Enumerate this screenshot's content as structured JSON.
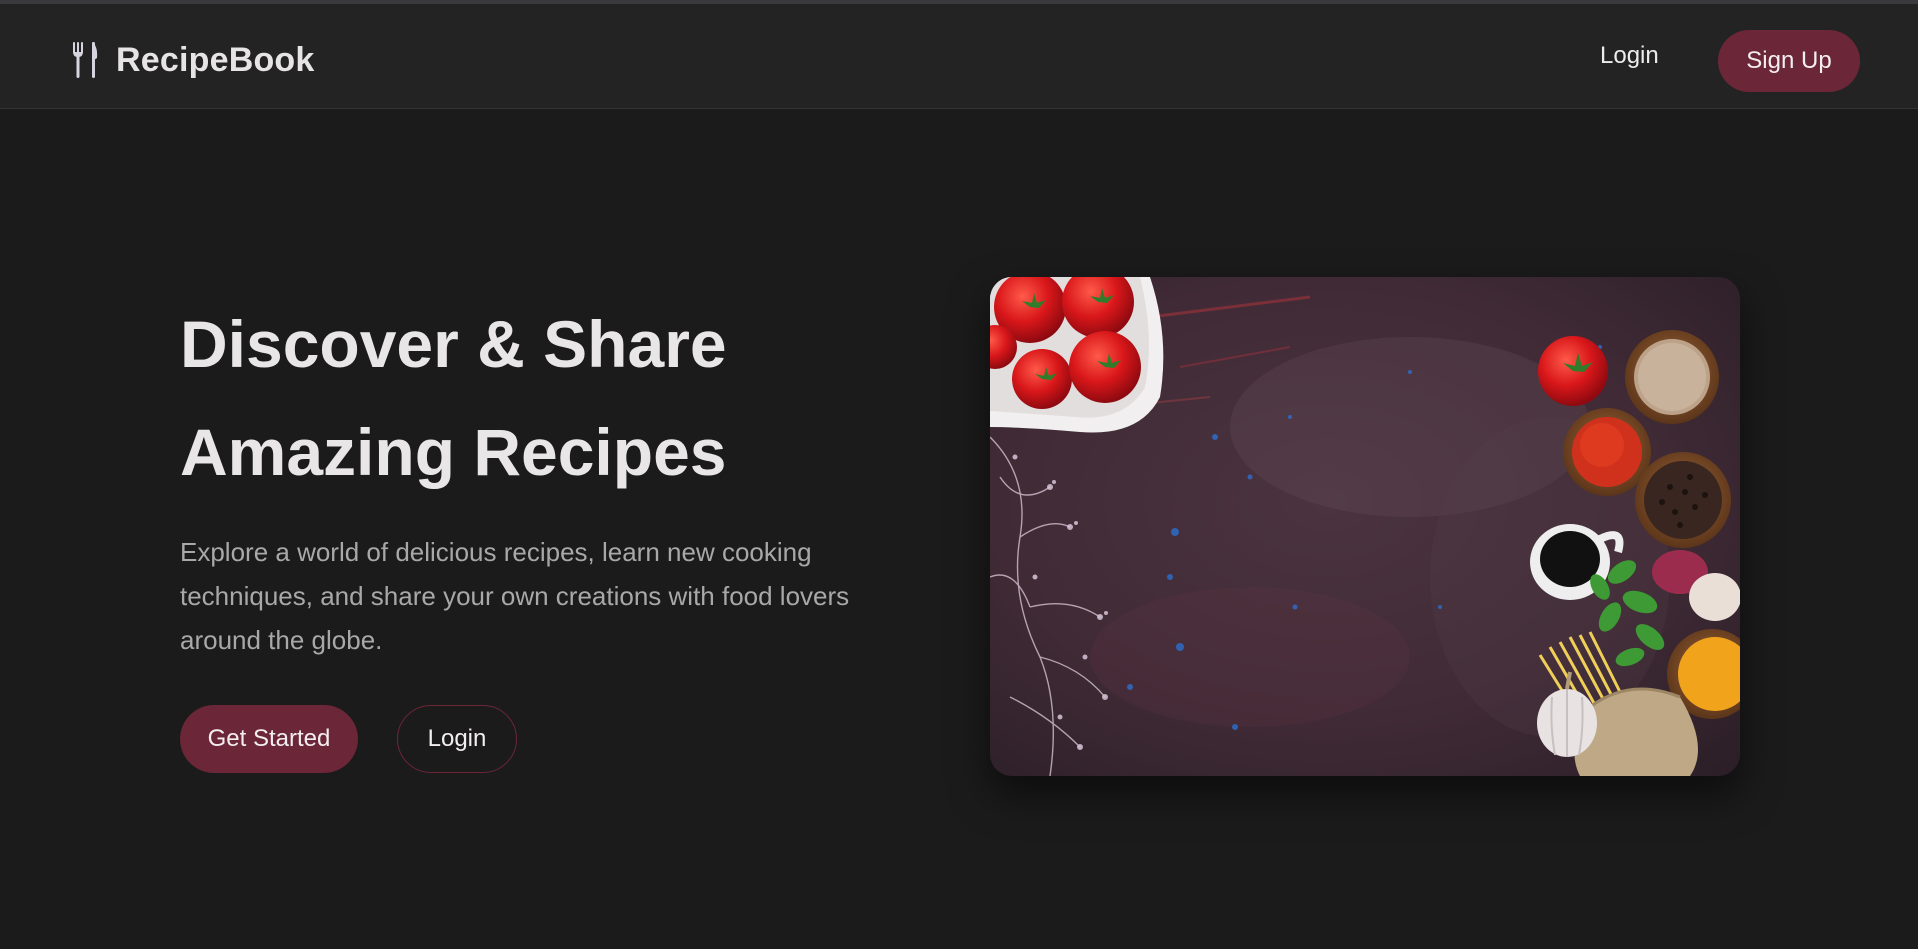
{
  "navbar": {
    "brand_icon": "fork-knife-icon",
    "brand_name": "RecipeBook",
    "login_label": "Login",
    "signup_label": "Sign Up"
  },
  "hero": {
    "title_line1": "Discover & Share",
    "title_line2": "Amazing Recipes",
    "description": "Explore a world of delicious recipes, learn new cooking techniques, and share your own creations with food lovers around the globe.",
    "primary_button": "Get Started",
    "secondary_button": "Login",
    "image_alt": "Overhead view of tomatoes, spices, pasta and herbs on a dark surface"
  },
  "colors": {
    "background": "#1b1b1c",
    "navbar": "#232324",
    "accent": "#6b2637",
    "heading": "#e8e6e6",
    "body_text": "#a9a8a8"
  }
}
